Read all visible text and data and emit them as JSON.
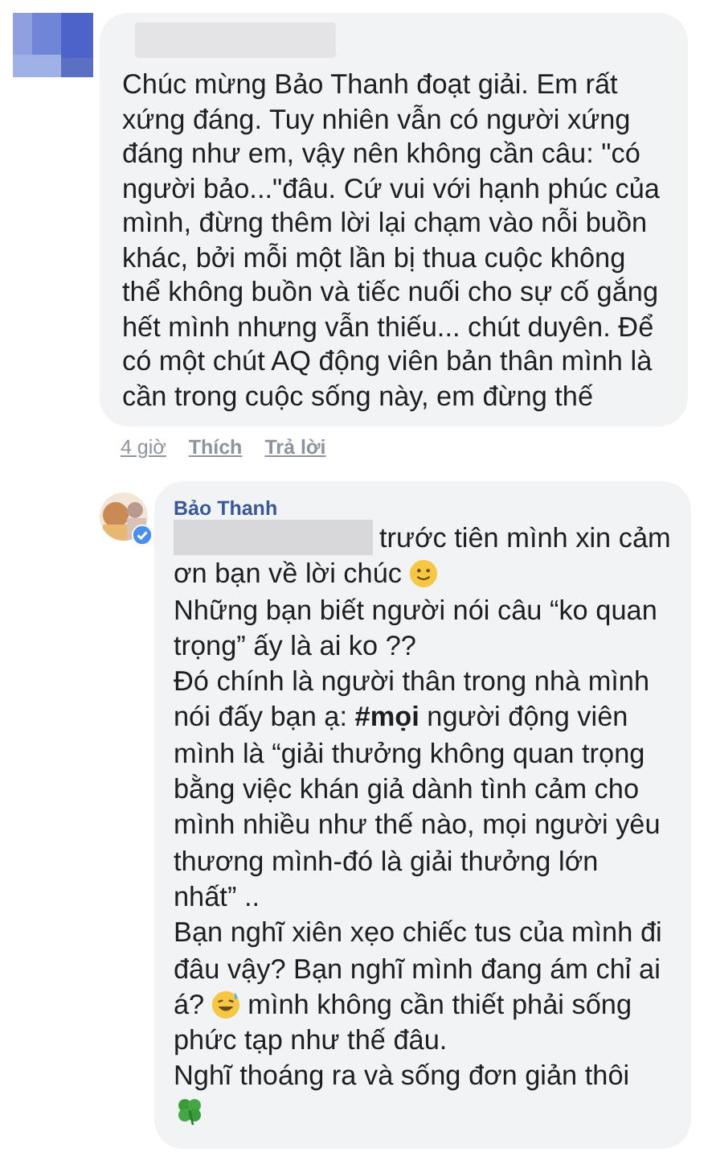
{
  "comment": {
    "lines": [
      "Chúc mừng Bảo Thanh đoạt giải. Em rất",
      "xứng đáng. Tuy nhiên vẫn có người xứng",
      "đáng như em, vậy nên không cần câu: \"có",
      "người bảo...\"đâu. Cứ vui với hạnh phúc của",
      "mình, đừng thêm lời lại chạm vào nỗi buồn",
      "khác, bởi mỗi một lần bị thua cuộc không",
      "thể không buồn và tiếc nuối cho sự cố gắng",
      "hết mình nhưng vẫn thiếu... chút duyên. Để",
      "có một chút AQ động viên bản thân mình là",
      "cần trong cuộc sống này, em đừng thế"
    ],
    "actions": [
      "4 giờ",
      "Thích",
      "Trả lời"
    ]
  },
  "reply": {
    "author": "Bảo Thanh",
    "verified": true,
    "lines": [
      [
        {
          "kind": "redacted"
        },
        {
          "kind": "text",
          "text": "trước tiên mình xin cảm"
        }
      ],
      [
        {
          "kind": "text",
          "text": "ơn bạn về lời chúc"
        },
        {
          "kind": "smile"
        }
      ],
      [
        {
          "kind": "text",
          "text": "Những bạn biết người nói câu “ko quan"
        }
      ],
      [
        {
          "kind": "text",
          "text": "trọng” ấy là ai ko ??"
        }
      ],
      [
        {
          "kind": "text",
          "text": "Đó chính là người thân trong nhà mình"
        }
      ],
      [
        {
          "kind": "text",
          "text": "nói đấy bạn ạ: **#mọi** người động viên"
        }
      ],
      [
        {
          "kind": "text",
          "text": "mình là “giải thưởng không quan trọng"
        }
      ],
      [
        {
          "kind": "text",
          "text": "bằng việc khán giả dành tình cảm cho"
        }
      ],
      [
        {
          "kind": "text",
          "text": "mình nhiều như thế nào, mọi người yêu"
        }
      ],
      [
        {
          "kind": "text",
          "text": "thương mình-đó là giải thưởng lớn"
        }
      ],
      [
        {
          "kind": "text",
          "text": "nhất” .."
        }
      ],
      [
        {
          "kind": "text",
          "text": "Bạn nghĩ xiên xẹo chiếc tus của mình đi"
        }
      ],
      [
        {
          "kind": "text",
          "text": "đâu vậy? Bạn nghĩ mình đang ám chỉ ai"
        }
      ],
      [
        {
          "kind": "text",
          "text": "á?"
        },
        {
          "kind": "sweat"
        },
        {
          "kind": "text",
          "text": "mình không cần thiết phải sống"
        }
      ],
      [
        {
          "kind": "text",
          "text": "phức tạp như thế đâu."
        }
      ],
      [
        {
          "kind": "text",
          "text": "Nghĩ thoáng ra và sống đơn giản thôi"
        }
      ],
      [
        {
          "kind": "clover"
        }
      ]
    ]
  }
}
